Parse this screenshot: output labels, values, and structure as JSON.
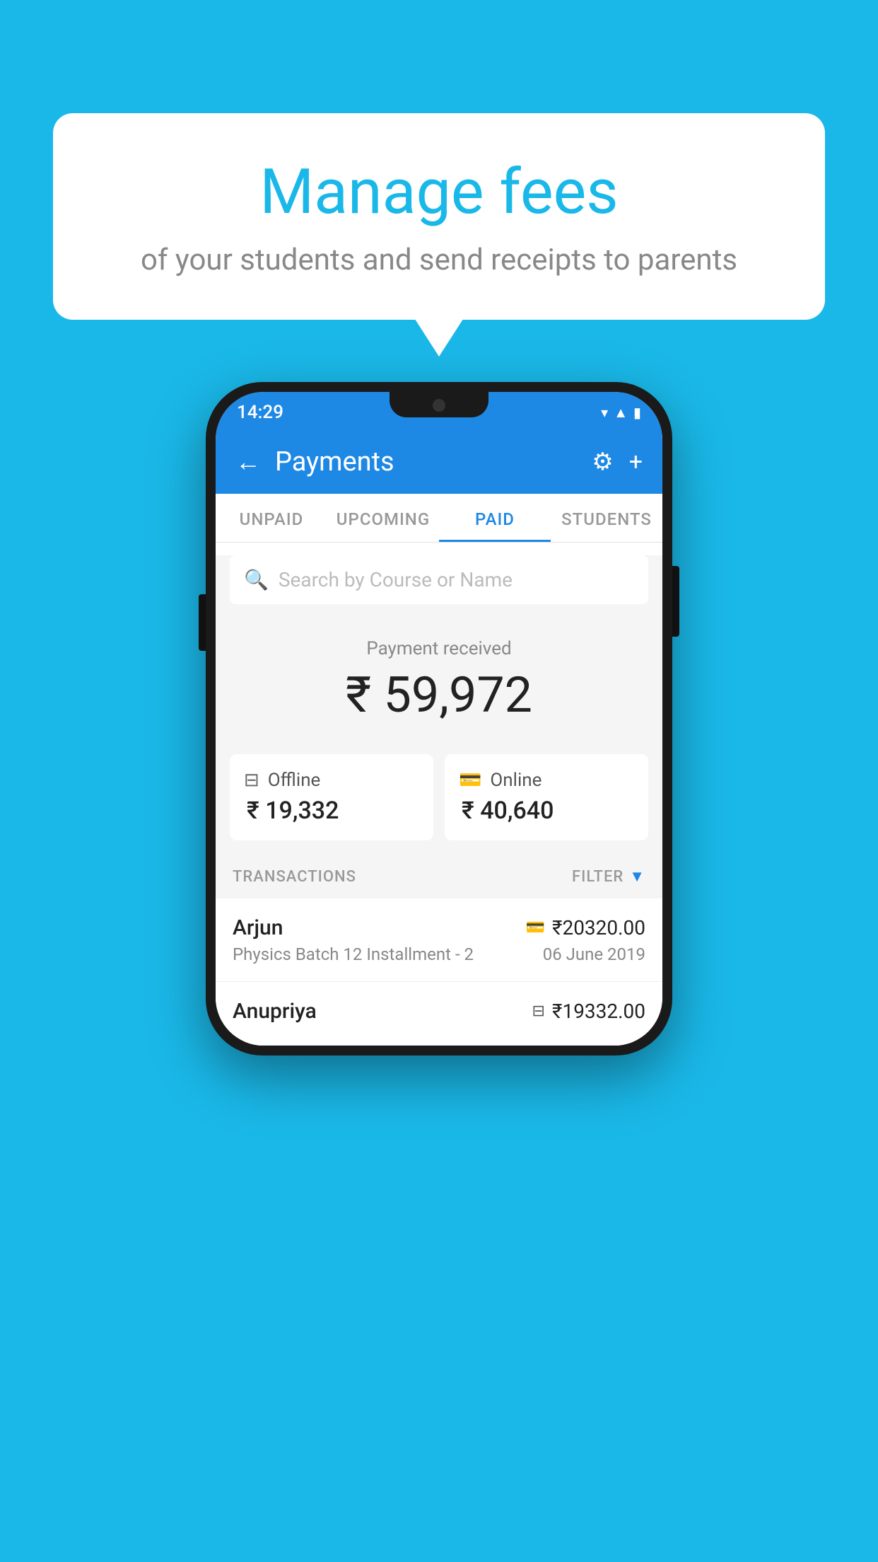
{
  "background_color": "#1ab8e8",
  "speech_bubble": {
    "title": "Manage fees",
    "subtitle": "of your students and send receipts to parents"
  },
  "status_bar": {
    "time": "14:29",
    "icons": [
      "wifi",
      "signal",
      "battery"
    ]
  },
  "header": {
    "title": "Payments",
    "back_label": "←",
    "settings_icon": "⚙",
    "add_icon": "+"
  },
  "tabs": [
    {
      "label": "UNPAID",
      "active": false
    },
    {
      "label": "UPCOMING",
      "active": false
    },
    {
      "label": "PAID",
      "active": true
    },
    {
      "label": "STUDENTS",
      "active": false
    }
  ],
  "search": {
    "placeholder": "Search by Course or Name"
  },
  "payment_summary": {
    "label": "Payment received",
    "amount": "₹ 59,972",
    "offline_label": "Offline",
    "offline_amount": "₹ 19,332",
    "online_label": "Online",
    "online_amount": "₹ 40,640"
  },
  "transactions_section": {
    "label": "TRANSACTIONS",
    "filter_label": "FILTER"
  },
  "transactions": [
    {
      "name": "Arjun",
      "amount": "₹20320.00",
      "payment_type": "card",
      "course": "Physics Batch 12 Installment - 2",
      "date": "06 June 2019"
    },
    {
      "name": "Anupriya",
      "amount": "₹19332.00",
      "payment_type": "cash",
      "course": "",
      "date": ""
    }
  ]
}
